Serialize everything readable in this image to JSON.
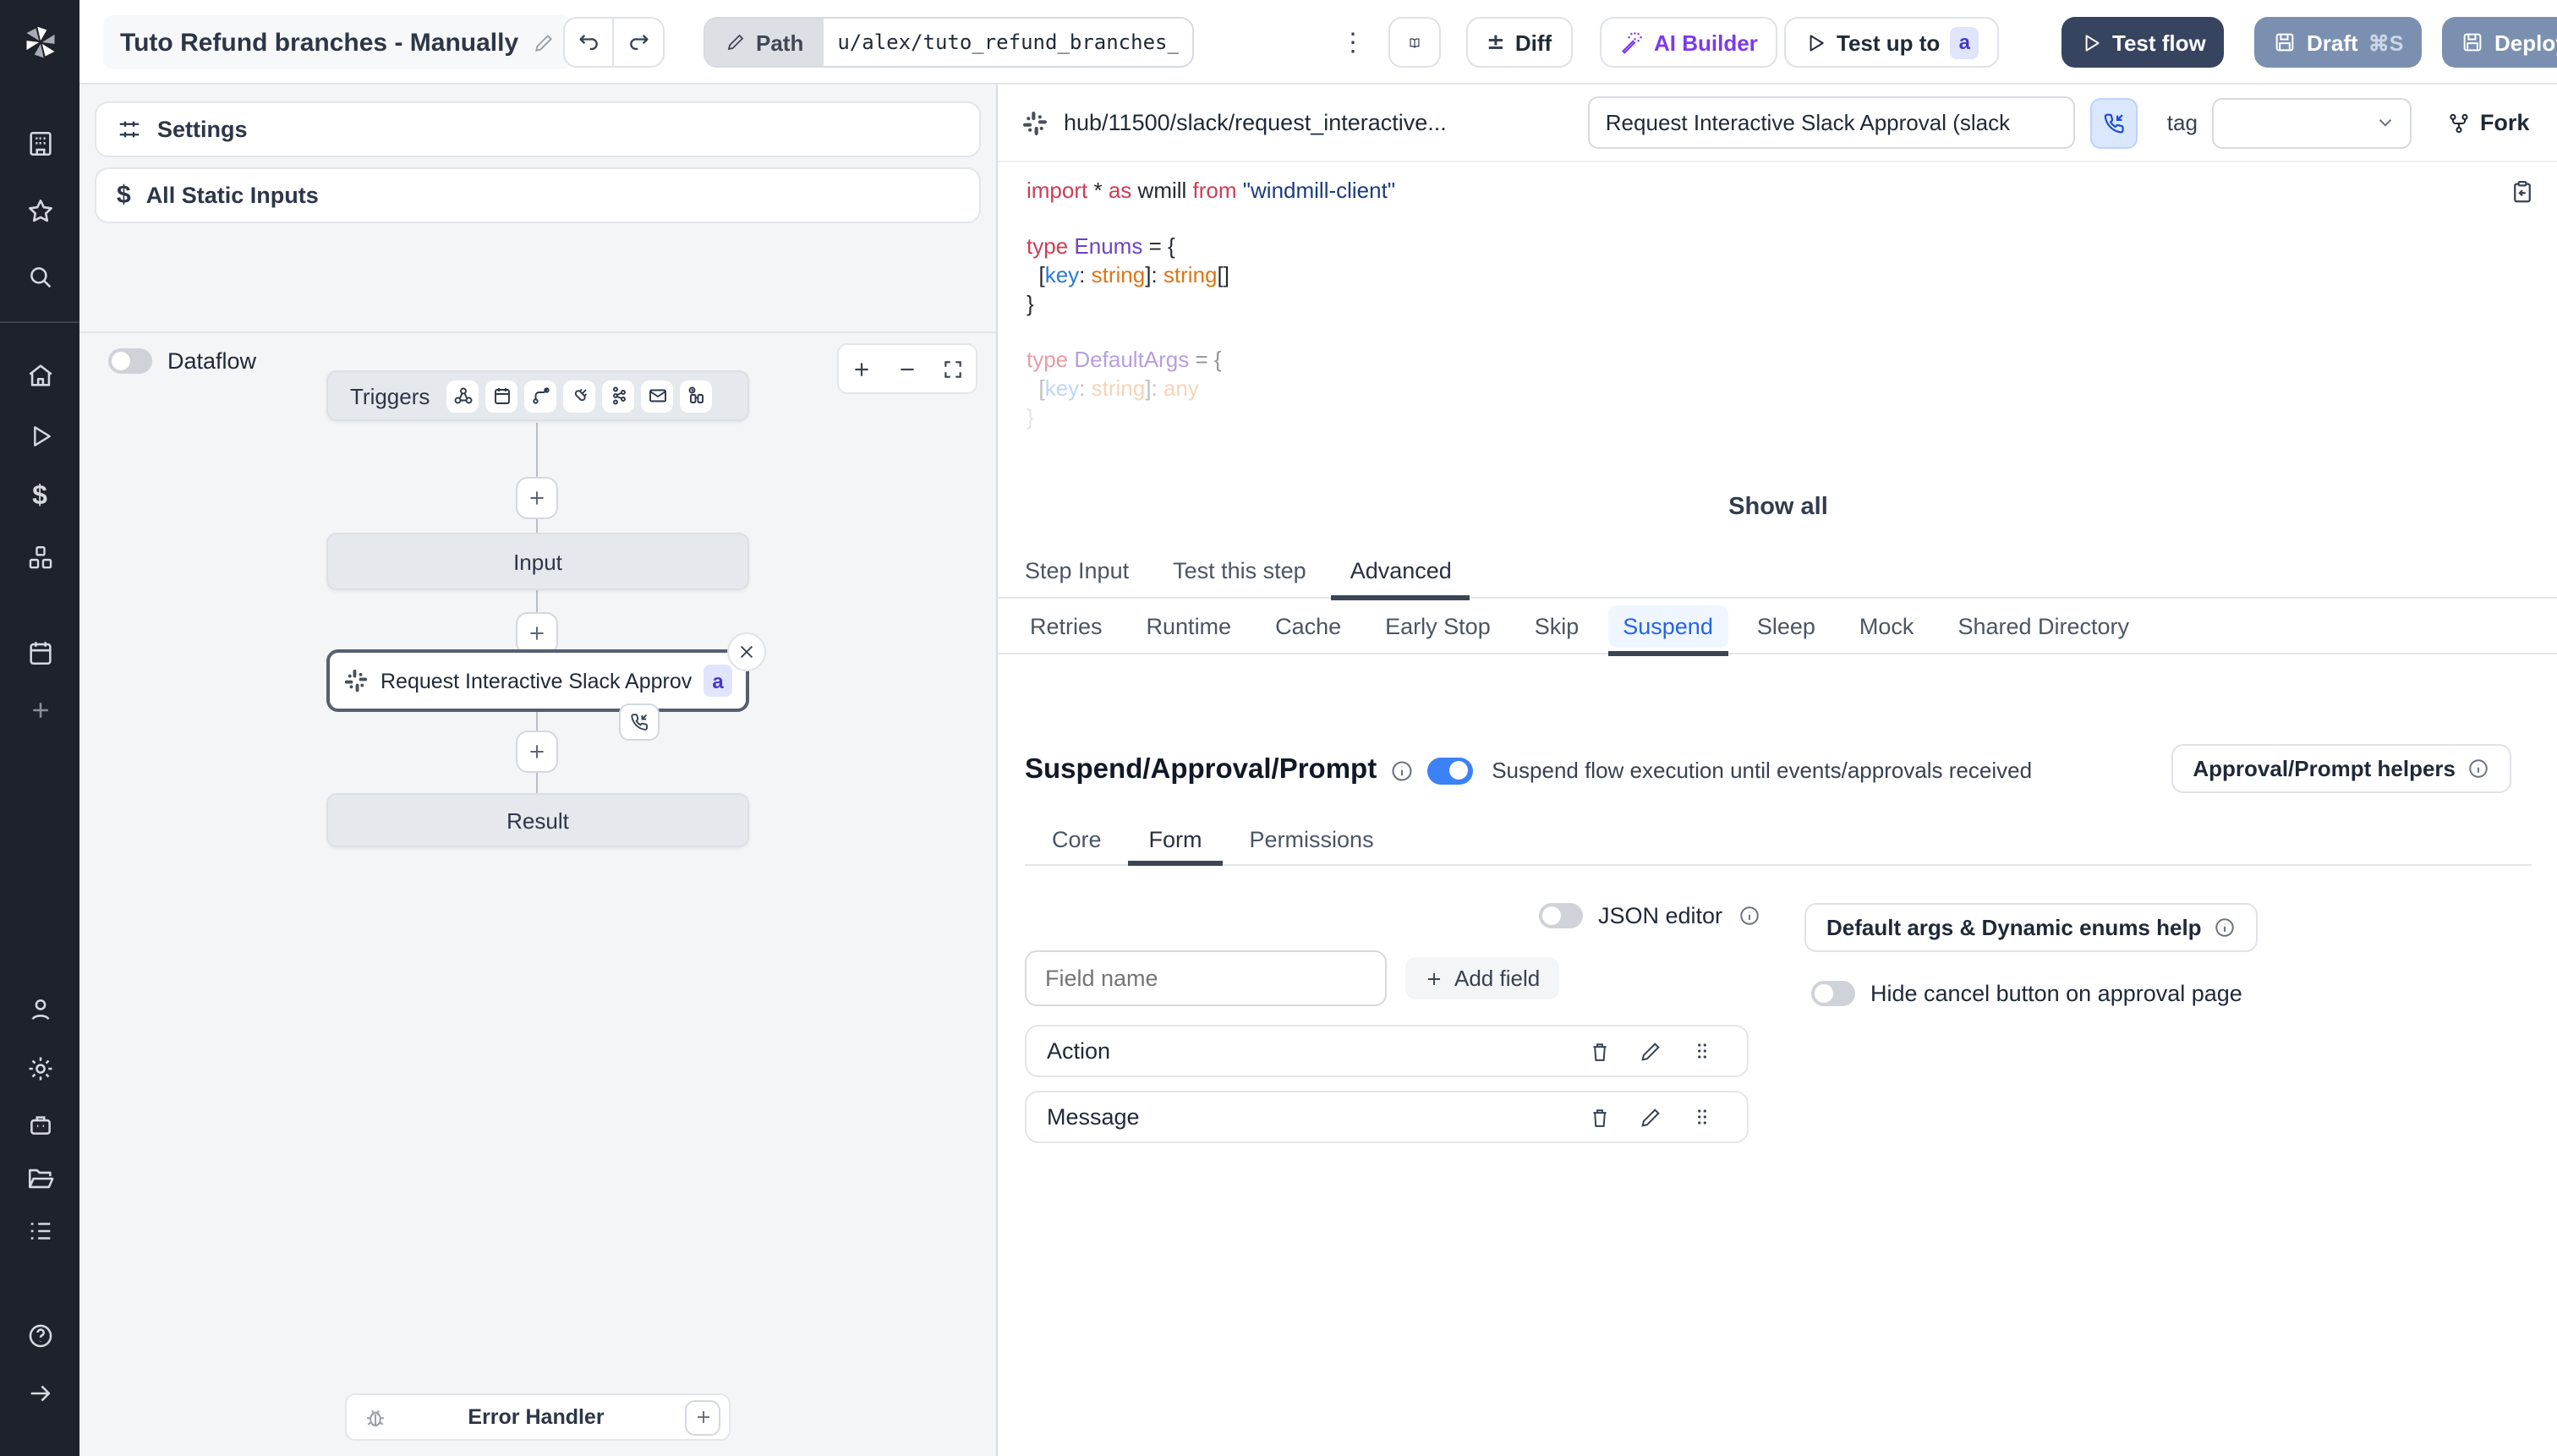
{
  "topbar": {
    "title": "Tuto Refund branches - Manually",
    "path_label": "Path",
    "path_value": "u/alex/tuto_refund_branches__",
    "diff_label": "Diff",
    "ai_builder_label": "AI Builder",
    "test_up_to_label": "Test up to",
    "test_up_to_badge": "a",
    "test_flow_label": "Test flow",
    "draft_label": "Draft",
    "draft_shortcut": "⌘S",
    "deploy_label": "Deploy"
  },
  "left_panel": {
    "settings_label": "Settings",
    "static_inputs_label": "All Static Inputs",
    "dataflow_label": "Dataflow",
    "graph": {
      "triggers_label": "Triggers",
      "input_label": "Input",
      "step_label": "Request Interactive Slack Approval (...",
      "step_badge": "a",
      "result_label": "Result",
      "error_handler_label": "Error Handler"
    }
  },
  "right_panel": {
    "hub_path": "hub/11500/slack/request_interactive...",
    "name_value": "Request Interactive Slack Approval (slack",
    "tag_label": "tag",
    "fork_label": "Fork",
    "show_all_label": "Show all",
    "code_lines": [
      {
        "o": 1,
        "s": [
          [
            "import",
            "kw"
          ],
          [
            " * ",
            "pl"
          ],
          [
            "as",
            "kw"
          ],
          [
            " wmill ",
            "pl"
          ],
          [
            "from",
            "kw"
          ],
          [
            " ",
            "pl"
          ],
          [
            "\"windmill-client\"",
            "str"
          ]
        ]
      },
      {
        "o": 1,
        "s": []
      },
      {
        "o": 1,
        "s": [
          [
            "type",
            "kw"
          ],
          [
            " ",
            "pl"
          ],
          [
            "Enums",
            "type"
          ],
          [
            " = {",
            "pl"
          ]
        ]
      },
      {
        "o": 1,
        "s": [
          [
            "  [",
            "pl"
          ],
          [
            "key",
            "key"
          ],
          [
            ": ",
            "pl"
          ],
          [
            "string",
            "orange"
          ],
          [
            "]: ",
            "pl"
          ],
          [
            "string",
            "orange"
          ],
          [
            "[]",
            "pl"
          ]
        ]
      },
      {
        "o": 1,
        "s": [
          [
            "}",
            "pl"
          ]
        ]
      },
      {
        "o": 1,
        "s": []
      },
      {
        "o": 0.5,
        "s": [
          [
            "type",
            "kw"
          ],
          [
            " ",
            "pl"
          ],
          [
            "DefaultArgs",
            "type"
          ],
          [
            " = {",
            "pl"
          ]
        ]
      },
      {
        "o": 0.3,
        "s": [
          [
            "  [",
            "pl"
          ],
          [
            "key",
            "key"
          ],
          [
            ": ",
            "pl"
          ],
          [
            "string",
            "orange"
          ],
          [
            "]: ",
            "pl"
          ],
          [
            "any",
            "orange"
          ]
        ]
      },
      {
        "o": 0.12,
        "s": [
          [
            "}",
            "pl"
          ]
        ]
      }
    ],
    "tabs": [
      "Step Input",
      "Test this step",
      "Advanced"
    ],
    "subtabs": [
      "Retries",
      "Runtime",
      "Cache",
      "Early Stop",
      "Skip",
      "Suspend",
      "Sleep",
      "Mock",
      "Shared Directory"
    ],
    "suspend": {
      "heading": "Suspend/Approval/Prompt",
      "toggle_desc": "Suspend flow execution until events/approvals received",
      "helpers_label": "Approval/Prompt helpers",
      "inner_tabs": [
        "Core",
        "Form",
        "Permissions"
      ],
      "json_editor_label": "JSON editor",
      "field_placeholder": "Field name",
      "add_field_label": "Add field",
      "fields": [
        "Action",
        "Message"
      ],
      "default_args_label": "Default args & Dynamic enums help",
      "hide_cancel_label": "Hide cancel button on approval page"
    }
  },
  "colors": {
    "accent_blue": "#3c82f6",
    "suspend_active": "#2563eb",
    "ai_purple": "#7c3aed",
    "test_flow_bg": "#36445f",
    "draft_deploy_bg": "#7b90b0",
    "sidebar_bg": "#1e222a"
  }
}
